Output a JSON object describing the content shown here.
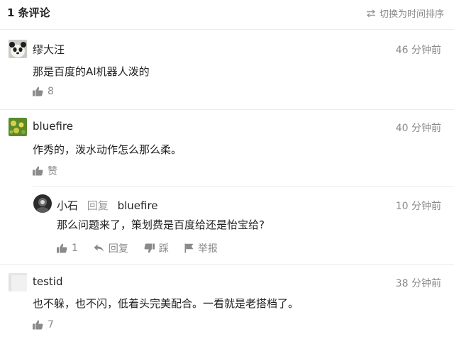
{
  "header": {
    "comment_count": "1 条评论",
    "sort_label": "切换为时间排序"
  },
  "comments": [
    {
      "name": "缪大汪",
      "time": "46 分钟前",
      "text": "那是百度的AI机器人泼的",
      "likes": "8"
    },
    {
      "name": "bluefire",
      "time": "40 分钟前",
      "text": "作秀的，泼水动作怎么那么柔。",
      "likes": "赞"
    },
    {
      "name": "小石",
      "reply_word": "回复",
      "reply_to": "bluefire",
      "time": "10 分钟前",
      "text": "那么问题来了，策划费是百度给还是怡宝给?",
      "likes": "1",
      "actions": {
        "reply": "回复",
        "dislike": "踩",
        "report": "举报"
      }
    },
    {
      "name": "testid",
      "time": "38 分钟前",
      "text": "也不躲，也不闪，低着头完美配合。一看就是老搭档了。",
      "likes": "7"
    }
  ],
  "colors": {
    "text": "#222222",
    "muted": "#8a8a8a",
    "divider": "#ececec"
  }
}
